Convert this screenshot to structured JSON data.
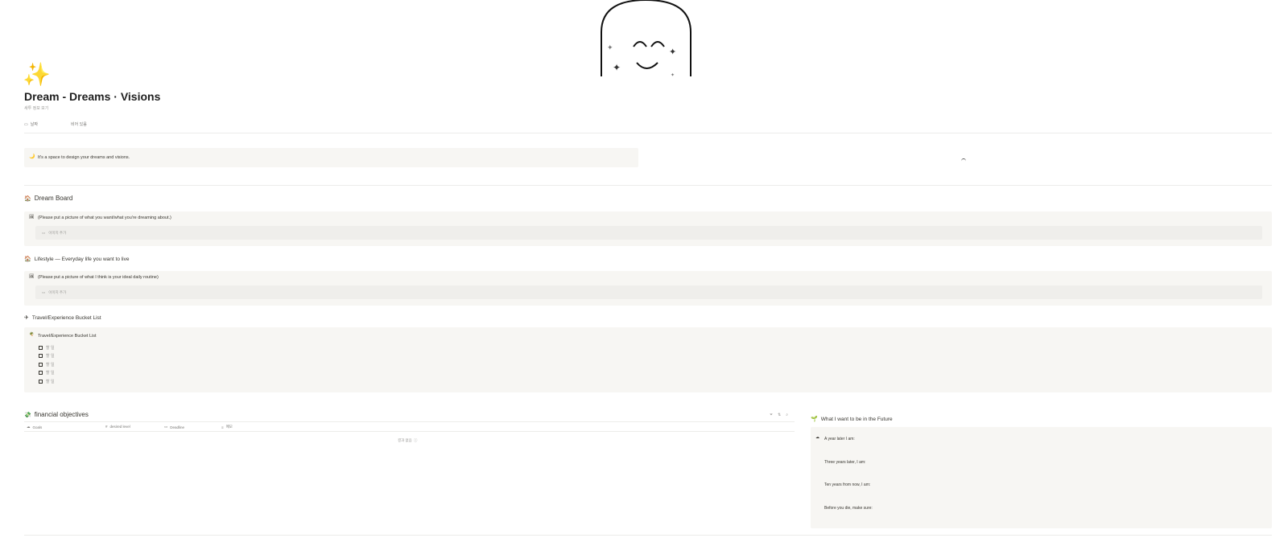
{
  "page": {
    "icon": "sparkles-icon",
    "title": "Dream - Dreams · Visions",
    "subtitle": "새투 정보 보기",
    "property": {
      "label": "날짜",
      "value": "비어 있음"
    }
  },
  "intro_callout": {
    "icon": "moon-icon",
    "text": "It's a space to design your dreams and visions."
  },
  "dream_board": {
    "heading": "Dream Board",
    "heading_icon": "house-icon",
    "callout_text": "(Please put a picture of what you want/what you're dreaming about.)",
    "add_image_label": "이미지 추가"
  },
  "lifestyle": {
    "heading": "Lifestyle — Everyday life you want to live",
    "heading_icon": "house-icon",
    "callout_text": "(Please put a picture of what I think is your ideal daily routine)",
    "add_image_label": "이미지 추가"
  },
  "travel": {
    "heading": "Travel/Experience Bucket List",
    "heading_icon": "airplane-icon",
    "callout_title": "Travel/Experience Bucket List",
    "todos": [
      "할 일",
      "할 일",
      "할 일",
      "할 일",
      "할 일"
    ]
  },
  "financial": {
    "heading": "financial objectives",
    "heading_icon": "money-icon",
    "columns": [
      "Goals",
      "desired level",
      "Deadline",
      "메모"
    ],
    "empty_text": "결과 없음"
  },
  "future": {
    "heading": "What I want to be in the Future",
    "heading_icon": "seedling-icon",
    "items": [
      "A year later I am:",
      "Three years later, I am:",
      "Ten years from now, I am:",
      "Before you die, make sure:"
    ]
  }
}
